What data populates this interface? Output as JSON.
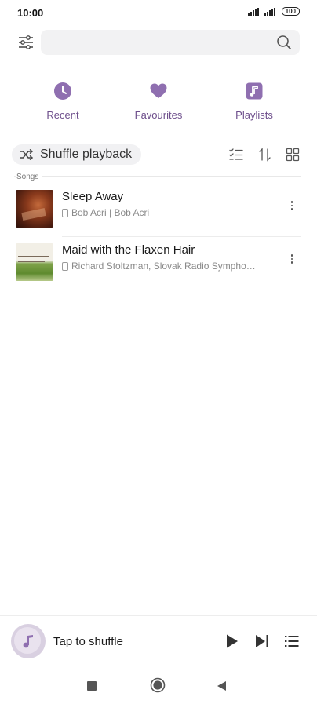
{
  "status_bar": {
    "time": "10:00",
    "battery": "100"
  },
  "search": {
    "placeholder": ""
  },
  "quick_links": [
    {
      "label": "Recent",
      "icon": "clock-icon"
    },
    {
      "label": "Favourites",
      "icon": "heart-icon"
    },
    {
      "label": "Playlists",
      "icon": "music-note-icon"
    }
  ],
  "toolbar": {
    "shuffle_label": "Shuffle playback"
  },
  "section": {
    "label": "Songs"
  },
  "songs": [
    {
      "title": "Sleep Away",
      "subtitle": "Bob Acri | Bob Acri"
    },
    {
      "title": "Maid with the Flaxen Hair",
      "subtitle": "Richard Stoltzman, Slovak Radio Sympho…"
    }
  ],
  "player": {
    "label": "Tap to shuffle"
  },
  "colors": {
    "accent": "#8f6fb0",
    "accent_text": "#6e4f8c"
  }
}
